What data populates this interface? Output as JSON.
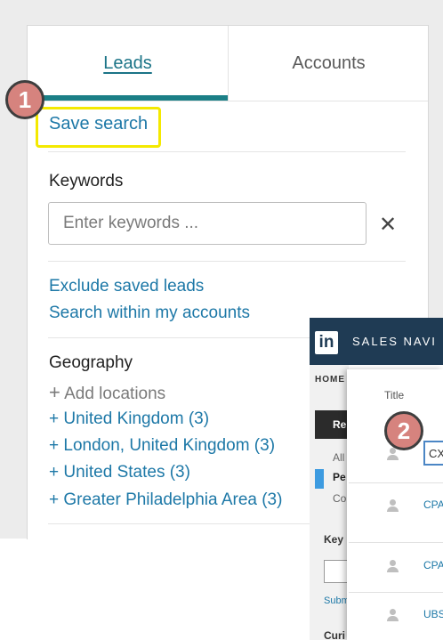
{
  "tabs": {
    "leads": "Leads",
    "accounts": "Accounts"
  },
  "save_search": "Save search",
  "badges": [
    "1",
    "2"
  ],
  "keywords": {
    "heading": "Keywords",
    "placeholder": "Enter keywords ..."
  },
  "links": {
    "exclude_saved": "Exclude saved leads",
    "search_within": "Search within my accounts"
  },
  "geography": {
    "heading": "Geography",
    "add_locations": "Add locations",
    "items": [
      "+ United Kingdom (3)",
      "+ London, United Kingdom (3)",
      "+ United States (3)",
      "+ Greater Philadelphia Area (3)"
    ]
  },
  "sales_nav": {
    "logo": "in",
    "title": "SALES NAVI",
    "home": "HOME",
    "re": "Re",
    "all": "All",
    "pe": "Pe",
    "co": "Co",
    "key": "Key",
    "subm": "Subm",
    "cur": "Curi",
    "title_label": "Title",
    "cx": "CX",
    "rows": [
      "CPA",
      "CPA",
      "UBS"
    ]
  },
  "colors": {
    "accent_teal": "#1b7f86",
    "link_blue": "#1d78a7",
    "highlight_yellow": "#f4e900",
    "badge_fill": "#d6837e",
    "sales_nav_header": "#1f3b54"
  }
}
